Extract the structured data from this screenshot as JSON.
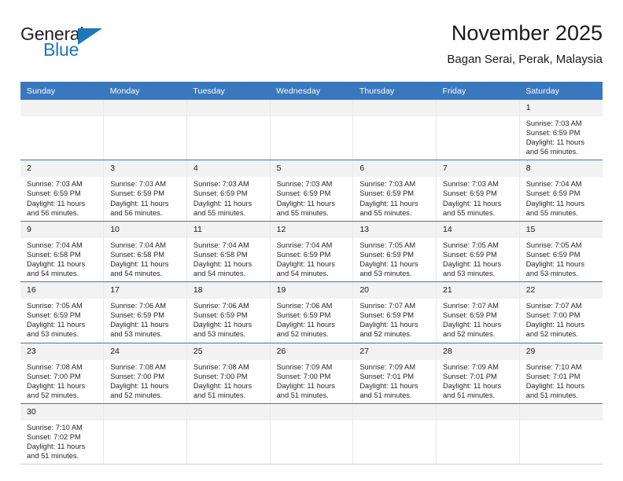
{
  "brand": {
    "name_part1": "General",
    "name_part2": "Blue",
    "accent_color": "#1f76bc"
  },
  "header": {
    "title": "November 2025",
    "subtitle": "Bagan Serai, Perak, Malaysia"
  },
  "theme": {
    "header_row_color": "#3a78bd",
    "daynum_band_color": "#f2f2f2",
    "grid_line_color": "#3a78bd"
  },
  "weekdays": [
    "Sunday",
    "Monday",
    "Tuesday",
    "Wednesday",
    "Thursday",
    "Friday",
    "Saturday"
  ],
  "weeks": [
    [
      {
        "day": "",
        "blank": true,
        "lines": []
      },
      {
        "day": "",
        "blank": true,
        "lines": []
      },
      {
        "day": "",
        "blank": true,
        "lines": []
      },
      {
        "day": "",
        "blank": true,
        "lines": []
      },
      {
        "day": "",
        "blank": true,
        "lines": []
      },
      {
        "day": "",
        "blank": true,
        "lines": []
      },
      {
        "day": "1",
        "blank": false,
        "lines": [
          "Sunrise: 7:03 AM",
          "Sunset: 6:59 PM",
          "Daylight: 11 hours",
          "and 56 minutes."
        ]
      }
    ],
    [
      {
        "day": "2",
        "blank": false,
        "lines": [
          "Sunrise: 7:03 AM",
          "Sunset: 6:59 PM",
          "Daylight: 11 hours",
          "and 56 minutes."
        ]
      },
      {
        "day": "3",
        "blank": false,
        "lines": [
          "Sunrise: 7:03 AM",
          "Sunset: 6:59 PM",
          "Daylight: 11 hours",
          "and 56 minutes."
        ]
      },
      {
        "day": "4",
        "blank": false,
        "lines": [
          "Sunrise: 7:03 AM",
          "Sunset: 6:59 PM",
          "Daylight: 11 hours",
          "and 55 minutes."
        ]
      },
      {
        "day": "5",
        "blank": false,
        "lines": [
          "Sunrise: 7:03 AM",
          "Sunset: 6:59 PM",
          "Daylight: 11 hours",
          "and 55 minutes."
        ]
      },
      {
        "day": "6",
        "blank": false,
        "lines": [
          "Sunrise: 7:03 AM",
          "Sunset: 6:59 PM",
          "Daylight: 11 hours",
          "and 55 minutes."
        ]
      },
      {
        "day": "7",
        "blank": false,
        "lines": [
          "Sunrise: 7:03 AM",
          "Sunset: 6:59 PM",
          "Daylight: 11 hours",
          "and 55 minutes."
        ]
      },
      {
        "day": "8",
        "blank": false,
        "lines": [
          "Sunrise: 7:04 AM",
          "Sunset: 6:59 PM",
          "Daylight: 11 hours",
          "and 55 minutes."
        ]
      }
    ],
    [
      {
        "day": "9",
        "blank": false,
        "lines": [
          "Sunrise: 7:04 AM",
          "Sunset: 6:58 PM",
          "Daylight: 11 hours",
          "and 54 minutes."
        ]
      },
      {
        "day": "10",
        "blank": false,
        "lines": [
          "Sunrise: 7:04 AM",
          "Sunset: 6:58 PM",
          "Daylight: 11 hours",
          "and 54 minutes."
        ]
      },
      {
        "day": "11",
        "blank": false,
        "lines": [
          "Sunrise: 7:04 AM",
          "Sunset: 6:58 PM",
          "Daylight: 11 hours",
          "and 54 minutes."
        ]
      },
      {
        "day": "12",
        "blank": false,
        "lines": [
          "Sunrise: 7:04 AM",
          "Sunset: 6:59 PM",
          "Daylight: 11 hours",
          "and 54 minutes."
        ]
      },
      {
        "day": "13",
        "blank": false,
        "lines": [
          "Sunrise: 7:05 AM",
          "Sunset: 6:59 PM",
          "Daylight: 11 hours",
          "and 53 minutes."
        ]
      },
      {
        "day": "14",
        "blank": false,
        "lines": [
          "Sunrise: 7:05 AM",
          "Sunset: 6:59 PM",
          "Daylight: 11 hours",
          "and 53 minutes."
        ]
      },
      {
        "day": "15",
        "blank": false,
        "lines": [
          "Sunrise: 7:05 AM",
          "Sunset: 6:59 PM",
          "Daylight: 11 hours",
          "and 53 minutes."
        ]
      }
    ],
    [
      {
        "day": "16",
        "blank": false,
        "lines": [
          "Sunrise: 7:05 AM",
          "Sunset: 6:59 PM",
          "Daylight: 11 hours",
          "and 53 minutes."
        ]
      },
      {
        "day": "17",
        "blank": false,
        "lines": [
          "Sunrise: 7:06 AM",
          "Sunset: 6:59 PM",
          "Daylight: 11 hours",
          "and 53 minutes."
        ]
      },
      {
        "day": "18",
        "blank": false,
        "lines": [
          "Sunrise: 7:06 AM",
          "Sunset: 6:59 PM",
          "Daylight: 11 hours",
          "and 53 minutes."
        ]
      },
      {
        "day": "19",
        "blank": false,
        "lines": [
          "Sunrise: 7:06 AM",
          "Sunset: 6:59 PM",
          "Daylight: 11 hours",
          "and 52 minutes."
        ]
      },
      {
        "day": "20",
        "blank": false,
        "lines": [
          "Sunrise: 7:07 AM",
          "Sunset: 6:59 PM",
          "Daylight: 11 hours",
          "and 52 minutes."
        ]
      },
      {
        "day": "21",
        "blank": false,
        "lines": [
          "Sunrise: 7:07 AM",
          "Sunset: 6:59 PM",
          "Daylight: 11 hours",
          "and 52 minutes."
        ]
      },
      {
        "day": "22",
        "blank": false,
        "lines": [
          "Sunrise: 7:07 AM",
          "Sunset: 7:00 PM",
          "Daylight: 11 hours",
          "and 52 minutes."
        ]
      }
    ],
    [
      {
        "day": "23",
        "blank": false,
        "lines": [
          "Sunrise: 7:08 AM",
          "Sunset: 7:00 PM",
          "Daylight: 11 hours",
          "and 52 minutes."
        ]
      },
      {
        "day": "24",
        "blank": false,
        "lines": [
          "Sunrise: 7:08 AM",
          "Sunset: 7:00 PM",
          "Daylight: 11 hours",
          "and 52 minutes."
        ]
      },
      {
        "day": "25",
        "blank": false,
        "lines": [
          "Sunrise: 7:08 AM",
          "Sunset: 7:00 PM",
          "Daylight: 11 hours",
          "and 51 minutes."
        ]
      },
      {
        "day": "26",
        "blank": false,
        "lines": [
          "Sunrise: 7:09 AM",
          "Sunset: 7:00 PM",
          "Daylight: 11 hours",
          "and 51 minutes."
        ]
      },
      {
        "day": "27",
        "blank": false,
        "lines": [
          "Sunrise: 7:09 AM",
          "Sunset: 7:01 PM",
          "Daylight: 11 hours",
          "and 51 minutes."
        ]
      },
      {
        "day": "28",
        "blank": false,
        "lines": [
          "Sunrise: 7:09 AM",
          "Sunset: 7:01 PM",
          "Daylight: 11 hours",
          "and 51 minutes."
        ]
      },
      {
        "day": "29",
        "blank": false,
        "lines": [
          "Sunrise: 7:10 AM",
          "Sunset: 7:01 PM",
          "Daylight: 11 hours",
          "and 51 minutes."
        ]
      }
    ],
    [
      {
        "day": "30",
        "blank": false,
        "lines": [
          "Sunrise: 7:10 AM",
          "Sunset: 7:02 PM",
          "Daylight: 11 hours",
          "and 51 minutes."
        ]
      },
      {
        "day": "",
        "blank": true,
        "lines": []
      },
      {
        "day": "",
        "blank": true,
        "lines": []
      },
      {
        "day": "",
        "blank": true,
        "lines": []
      },
      {
        "day": "",
        "blank": true,
        "lines": []
      },
      {
        "day": "",
        "blank": true,
        "lines": []
      },
      {
        "day": "",
        "blank": true,
        "lines": []
      }
    ]
  ]
}
